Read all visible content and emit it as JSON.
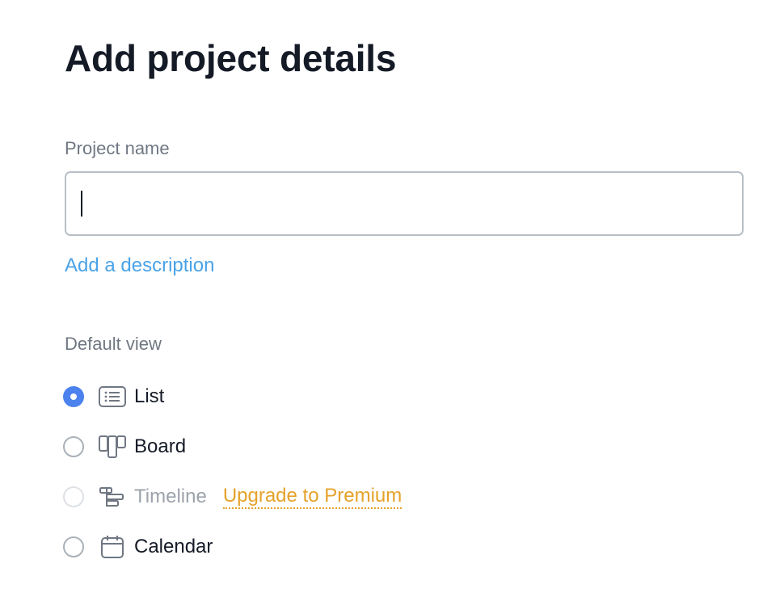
{
  "header": {
    "title": "Add project details"
  },
  "project_name": {
    "label": "Project name",
    "value": "",
    "placeholder": ""
  },
  "description_link": "Add a description",
  "default_view": {
    "label": "Default view",
    "selected": "List",
    "options": [
      {
        "label": "List",
        "icon": "list-icon",
        "state": "selected"
      },
      {
        "label": "Board",
        "icon": "board-icon",
        "state": "unselected"
      },
      {
        "label": "Timeline",
        "icon": "timeline-icon",
        "state": "disabled",
        "upgrade_label": "Upgrade to Premium"
      },
      {
        "label": "Calendar",
        "icon": "calendar-icon",
        "state": "unselected"
      }
    ]
  },
  "colors": {
    "title": "#151b26",
    "label": "#6f7782",
    "link": "#4aa3e8",
    "radio_selected": "#4c82ee",
    "upgrade": "#e5a22a",
    "disabled_text": "#9ca3ab",
    "input_border": "#b7bfc6"
  }
}
